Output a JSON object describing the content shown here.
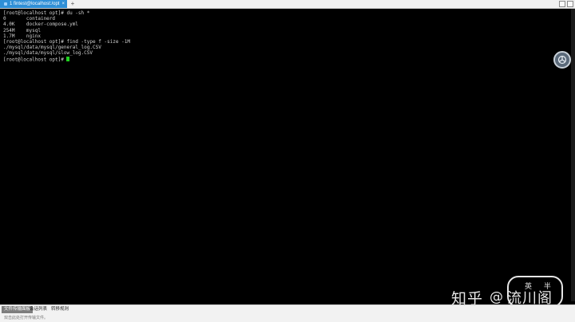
{
  "tab": {
    "title": "1 fintest@localhost:/opt",
    "close_icon": "×",
    "add_icon": "+"
  },
  "terminal": {
    "lines": [
      "[root@localhost opt]# du -sh *",
      "0       containerd",
      "4.0K    docker-compose.yml",
      "254M    mysql",
      "1.7M    nginx",
      "[root@localhost opt]# find -type f -size -1M",
      "./mysql/data/mysql/general_log.CSV",
      "./mysql/data/mysql/slow_log.CSV"
    ],
    "prompt": "[root@localhost opt]# "
  },
  "watermark": {
    "site": "知乎",
    "at": "@",
    "author": "流川阁",
    "badge": "英 半"
  },
  "bottom": {
    "tabs": [
      "文件传输面板",
      "会话列表",
      "转移规则"
    ],
    "status": "双击此处打开传输文件。"
  },
  "colors": {
    "accent": "#2f8fd6",
    "cursor": "#1fd11f",
    "terminal_bg": "#000000",
    "terminal_fg": "#d0d0d0"
  },
  "icons": {
    "float": "gear-icon"
  }
}
